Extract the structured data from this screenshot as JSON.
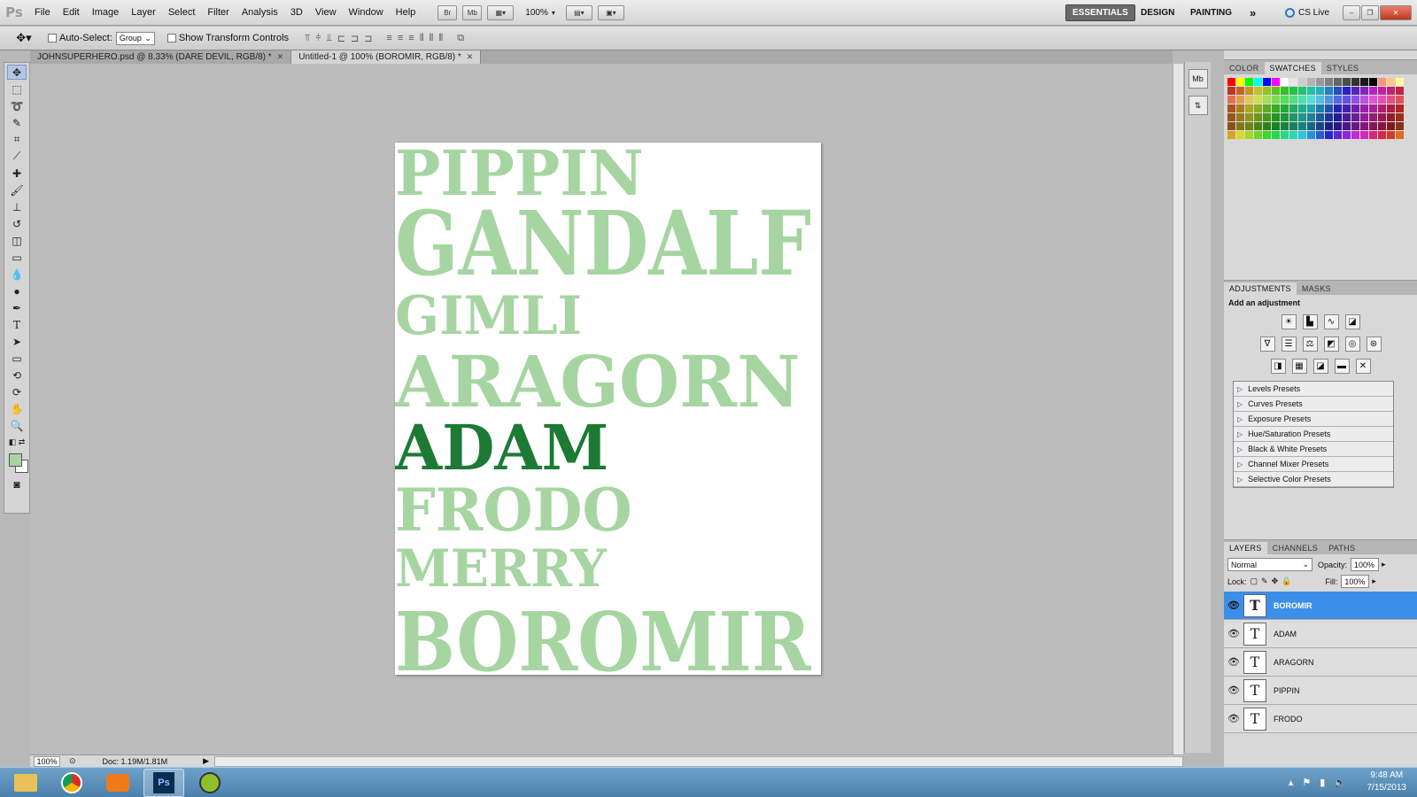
{
  "app": {
    "logo": "Ps"
  },
  "menu": [
    "File",
    "Edit",
    "Image",
    "Layer",
    "Select",
    "Filter",
    "Analysis",
    "3D",
    "View",
    "Window",
    "Help"
  ],
  "topbar": {
    "zoom": "100%",
    "workspaces": [
      "ESSENTIALS",
      "DESIGN",
      "PAINTING"
    ],
    "more": "»",
    "cslive": "CS Live"
  },
  "options": {
    "auto_select_label": "Auto-Select:",
    "auto_select_value": "Group",
    "show_transform_label": "Show Transform Controls"
  },
  "doc_tabs": [
    {
      "title": "JOHNSUPERHERO.psd @ 8.33% (DARE DEVIL, RGB/8) *"
    },
    {
      "title": "Untitled-1 @ 100% (BOROMIR, RGB/8) *"
    }
  ],
  "canvas_words": [
    {
      "text": "PIPPIN",
      "color": "#a6d5a2"
    },
    {
      "text": "GANDALF",
      "color": "#a6d5a2"
    },
    {
      "text": "GIMLI",
      "color": "#a6d5a2"
    },
    {
      "text": "ARAGORN",
      "color": "#a6d5a2"
    },
    {
      "text": "ADAM",
      "color": "#1c7a34"
    },
    {
      "text": "FRODO",
      "color": "#a6d5a2"
    },
    {
      "text": "MERRY",
      "color": "#a6d5a2"
    },
    {
      "text": "BOROMIR",
      "color": "#a6d5a2"
    }
  ],
  "status": {
    "zoom": "100%",
    "doc": "Doc: 1.19M/1.81M"
  },
  "panels": {
    "color_tabs": [
      "COLOR",
      "SWATCHES",
      "STYLES"
    ],
    "adjust_tabs": [
      "ADJUSTMENTS",
      "MASKS"
    ],
    "adjust_title": "Add an adjustment",
    "presets": [
      "Levels Presets",
      "Curves Presets",
      "Exposure Presets",
      "Hue/Saturation Presets",
      "Black & White Presets",
      "Channel Mixer Presets",
      "Selective Color Presets"
    ],
    "layer_tabs": [
      "LAYERS",
      "CHANNELS",
      "PATHS"
    ],
    "blend_mode": "Normal",
    "opacity_label": "Opacity:",
    "opacity": "100%",
    "lock_label": "Lock:",
    "fill_label": "Fill:",
    "fill": "100%",
    "layers": [
      "BOROMIR",
      "ADAM",
      "ARAGORN",
      "PIPPIN",
      "FRODO"
    ]
  },
  "taskbar": {
    "time": "9:48 AM",
    "date": "7/15/2013"
  }
}
